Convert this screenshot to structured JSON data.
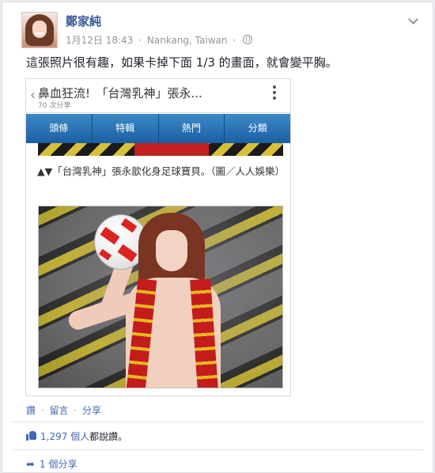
{
  "post": {
    "author": "鄭家純",
    "date": "1月12日 18:43",
    "location": "Nankang, Taiwan",
    "text": "這張照片很有趣，如果卡掉下面 1/3 的畫面，就會變平胸。",
    "avatar_icon": "profile-photo",
    "privacy_icon": "globe-icon",
    "menu_icon": "chevron-down-icon"
  },
  "embed": {
    "back_glyph": "‹",
    "title": "鼻血狂流!　「台灣乳神」張永...",
    "shares": "70 次分享",
    "nav": [
      "頭條",
      "特輯",
      "熱門",
      "分類"
    ],
    "caption": "▲▼「台灣乳神」張永歆化身足球寶貝。（圖／人人娛樂）",
    "nav_color": "#2b74b8"
  },
  "actions": {
    "like": "讚",
    "comment": "留言",
    "share": "分享",
    "separator": "·"
  },
  "likes": {
    "count": "1,297 個人",
    "suffix": "都說讚。",
    "icon": "thumbs-up-icon"
  },
  "shares": {
    "count": "1 個分享",
    "icon": "share-arrow-icon"
  },
  "colors": {
    "link": "#4267b2",
    "name": "#365899",
    "meta": "#90949c"
  }
}
